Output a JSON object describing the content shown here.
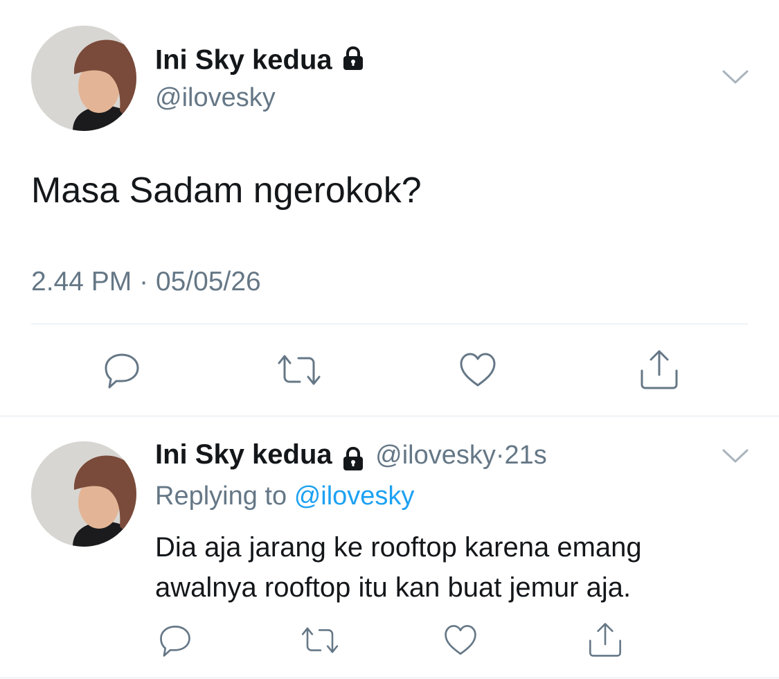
{
  "main_tweet": {
    "author_name": "Ini Sky kedua",
    "author_handle": "@ilovesky",
    "text": "Masa Sadam ngerokok?",
    "time": "2.44 PM",
    "separator": "·",
    "date": "05/05/26",
    "actions": [
      "reply-icon",
      "retweet-icon",
      "like-icon",
      "share-icon"
    ]
  },
  "reply_tweet": {
    "author_name": "Ini Sky kedua",
    "author_handle": "@ilovesky",
    "separator": "·",
    "age": "21s",
    "replying_label": "Replying to",
    "replying_mention": "@ilovesky",
    "text": "Dia aja jarang ke rooftop karena emang awalnya rooftop itu kan buat jemur aja.",
    "actions": [
      "reply-icon",
      "retweet-icon",
      "like-icon",
      "share-icon"
    ]
  },
  "colors": {
    "text_primary": "#14171a",
    "text_secondary": "#657786",
    "accent": "#1da1f2",
    "divider": "#e1e8ed"
  }
}
